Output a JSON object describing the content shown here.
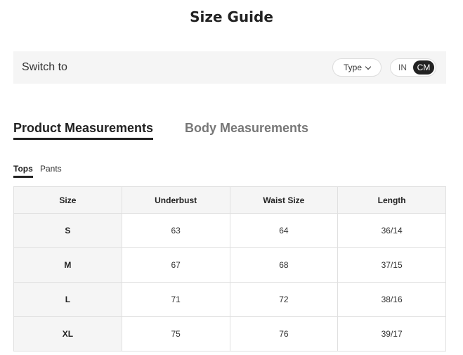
{
  "page": {
    "title": "Size Guide"
  },
  "switch_bar": {
    "label": "Switch to",
    "type_select": {
      "value": "Type"
    },
    "units": {
      "options": [
        "IN",
        "CM"
      ],
      "selected": "CM"
    }
  },
  "main_tabs": [
    {
      "label": "Product Measurements",
      "active": true
    },
    {
      "label": "Body Measurements",
      "active": false
    }
  ],
  "sub_tabs": [
    {
      "label": "Tops",
      "active": true
    },
    {
      "label": "Pants",
      "active": false
    }
  ],
  "table": {
    "headers": [
      "Size",
      "Underbust",
      "Waist Size",
      "Length"
    ],
    "rows": [
      [
        "S",
        "63",
        "64",
        "36/14"
      ],
      [
        "M",
        "67",
        "68",
        "37/15"
      ],
      [
        "L",
        "71",
        "72",
        "38/16"
      ],
      [
        "XL",
        "75",
        "76",
        "39/17"
      ]
    ]
  }
}
